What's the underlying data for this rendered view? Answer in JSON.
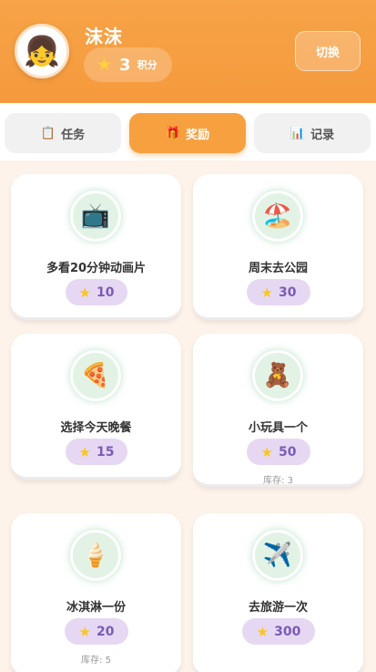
{
  "header": {
    "avatar_icon": "child-avatar-icon",
    "user_name": "沫沫",
    "points_value": "3",
    "points_unit": "积分",
    "switch_label": "切换"
  },
  "tabs": [
    {
      "label": "任务",
      "icon": "clipboard-icon",
      "active": false
    },
    {
      "label": "奖励",
      "icon": "gift-icon",
      "active": true
    },
    {
      "label": "记录",
      "icon": "bar-chart-icon",
      "active": false
    }
  ],
  "rewards": [
    {
      "title": "多看20分钟动画片",
      "cost": "10",
      "icon": "tv-icon"
    },
    {
      "title": "周末去公园",
      "cost": "30",
      "icon": "beach-icon"
    },
    {
      "title": "选择今天晚餐",
      "cost": "15",
      "icon": "pizza-icon"
    },
    {
      "title": "小玩具一个",
      "cost": "50",
      "icon": "teddy-bear-icon",
      "stock": "库存: 3"
    },
    {
      "title": "冰淇淋一份",
      "cost": "20",
      "icon": "ice-cream-icon",
      "stock": "库存: 5"
    },
    {
      "title": "去旅游一次",
      "cost": "300",
      "icon": "airplane-icon"
    }
  ],
  "colors": {
    "header": "#f59a3d",
    "active_tab": "#f7a040",
    "cost_pill": "#e6d8f3",
    "cost_text": "#7b5bb5",
    "star": "#f9c622"
  }
}
